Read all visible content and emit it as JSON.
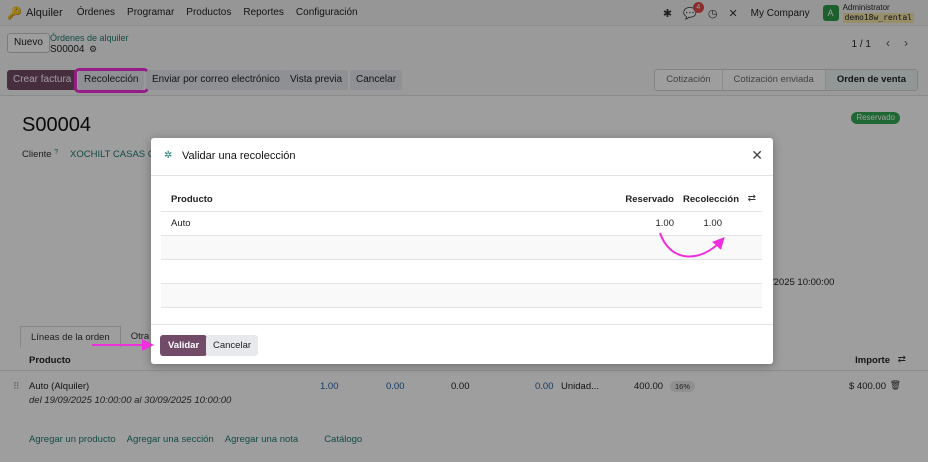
{
  "navbar": {
    "app_name": "Alquiler",
    "menu": [
      "Órdenes",
      "Programar",
      "Productos",
      "Reportes",
      "Configuración"
    ],
    "chat_badge": "4",
    "company": "My Company",
    "avatar_letter": "A",
    "user_name": "Administrator",
    "db_name": "demo18w_rental"
  },
  "control": {
    "new_label": "Nuevo",
    "breadcrumb": "Órdenes de alquiler",
    "record": "S00004",
    "pager": "1 / 1"
  },
  "actions": {
    "create_invoice": "Crear factura",
    "pickup": "Recolección",
    "send_email": "Enviar por correo electrónico",
    "preview": "Vista previa",
    "cancel": "Cancelar"
  },
  "status": {
    "stages": [
      "Cotización",
      "Cotización enviada",
      "Orden de venta"
    ],
    "active": "Orden de venta"
  },
  "form": {
    "title": "S00004",
    "badge": "Reservado",
    "client_label": "Cliente",
    "client_help": "?",
    "client_value": "XOCHILT CASAS CH",
    "date_fragment": "/2025 10:00:00",
    "tabs": [
      "Líneas de la orden",
      "Otra"
    ],
    "lines_header": {
      "product": "Producto",
      "amount": "Importe"
    },
    "line": {
      "name": "Auto (Alquiler)",
      "description": "del 19/09/2025 10:00:00 al 30/09/2025 10:00:00",
      "quantity": "1.00",
      "delivered": "0.00",
      "returned": "0.00",
      "invoiced": "0.00",
      "uom": "Unidad...",
      "price": "400.00",
      "tax": "16%",
      "amount": "$ 400.00"
    },
    "links": [
      "Agregar un producto",
      "Agregar una sección",
      "Agregar una nota",
      "Catálogo"
    ]
  },
  "modal": {
    "title": "Validar una recolección",
    "columns": {
      "product": "Producto",
      "reserved": "Reservado",
      "pickup": "Recolección"
    },
    "rows": [
      {
        "product": "Auto",
        "reserved": "1.00",
        "pickup": "1.00"
      }
    ],
    "validate": "Validar",
    "cancel": "Cancelar"
  },
  "colors": {
    "primary": "#714b67",
    "link": "#1f7a72",
    "annotation": "#ef2fdc",
    "success": "#35a853"
  },
  "icons": [
    "app-rental-icon",
    "bug-icon",
    "chat-icon",
    "clock-icon",
    "tools-icon",
    "gear-icon",
    "chevron-left-icon",
    "chevron-right-icon",
    "settings-sliders-icon",
    "drag-handle-icon",
    "trash-icon",
    "close-icon",
    "puzzle-icon"
  ]
}
